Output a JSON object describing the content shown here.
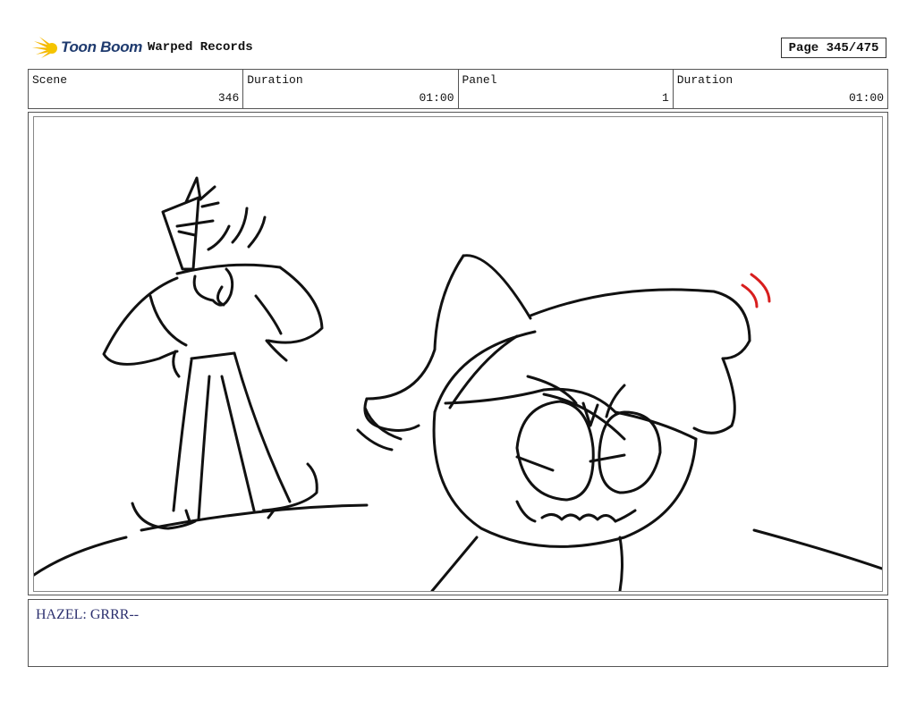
{
  "header": {
    "brand_name": "Toon Boom",
    "logo_icon": "sunburst-logo-icon",
    "brand_color": "#1e3a6e",
    "logo_accent_color": "#f5b700",
    "project_title": "Warped Records",
    "page_indicator": "Page 345/475"
  },
  "info": {
    "scene_label": "Scene",
    "scene_value": "346",
    "scene_duration_label": "Duration",
    "scene_duration_value": "01:00",
    "panel_label": "Panel",
    "panel_value": "1",
    "panel_duration_label": "Duration",
    "panel_duration_value": "01:00"
  },
  "panel": {
    "image_subject": "storyboard-sketch",
    "accent_stroke_color": "#d81e1e"
  },
  "dialogue": {
    "text": "HAZEL: GRRR--"
  }
}
